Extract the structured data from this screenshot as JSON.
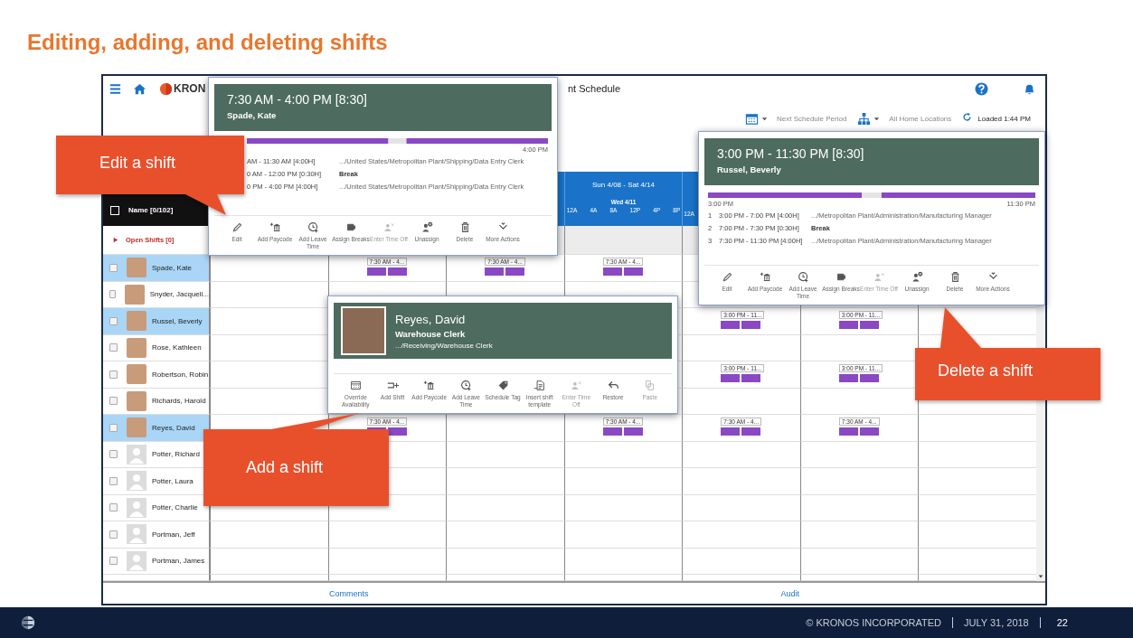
{
  "slide": {
    "title": "Editing, adding, and deleting shifts",
    "footer": {
      "copyright": "© KRONOS INCORPORATED",
      "date": "JULY 31, 2018",
      "page": "22"
    }
  },
  "app": {
    "logo_text": "KRON",
    "title": "nt Schedule",
    "toolbar": {
      "period": "Next Schedule Period",
      "locations": "All Home Locations",
      "loaded": "Loaded 1:44 PM"
    }
  },
  "schedule": {
    "range": "Sun 4/08 - Sat 4/14",
    "day": "Wed 4/11",
    "hours": [
      "12A",
      "4A",
      "8A",
      "12P",
      "4P",
      "8P",
      "12A"
    ],
    "name_header": "Name [0/102]",
    "select_all_checked": false,
    "open_shifts": "Open Shifts [0]",
    "employees": [
      {
        "name": "Spade, Kate",
        "selected": true,
        "checked": false,
        "has_photo": true,
        "shifts": {
          "mon": "7:30 AM - 4...",
          "tue": "7:30 AM - 4...",
          "wed": "7:30 AM - 4..."
        }
      },
      {
        "name": "Snyder, Jacqueli...",
        "selected": false,
        "checked": false,
        "has_photo": true
      },
      {
        "name": "Russel, Beverly",
        "selected": true,
        "checked": false,
        "has_photo": true,
        "shifts": {
          "thu": "3:00 PM - 11...",
          "fri": "3:00 PM - 11..."
        }
      },
      {
        "name": "Rose, Kathleen",
        "selected": false,
        "checked": false,
        "has_photo": true
      },
      {
        "name": "Robertson, Robin",
        "selected": false,
        "checked": false,
        "has_photo": true,
        "shifts": {
          "thu": "3:00 PM - 11...",
          "fri": "3:00 PM - 11..."
        }
      },
      {
        "name": "Richards, Harold",
        "selected": false,
        "checked": false,
        "has_photo": true
      },
      {
        "name": "Reyes, David",
        "selected": true,
        "checked": false,
        "has_photo": true,
        "shifts": {
          "mon": "7:30 AM - 4...",
          "wed": "7:30 AM - 4...",
          "thu": "7:30 AM - 4...",
          "fri": "7:30 AM - 4..."
        }
      },
      {
        "name": "Potter, Richard",
        "selected": false,
        "checked": false,
        "has_photo": false
      },
      {
        "name": "Potter, Laura",
        "selected": false,
        "checked": false,
        "has_photo": false
      },
      {
        "name": "Potter, Charlie",
        "selected": false,
        "checked": false,
        "has_photo": false
      },
      {
        "name": "Portman, Jeff",
        "selected": false,
        "checked": false,
        "has_photo": false
      },
      {
        "name": "Portman, James",
        "selected": false,
        "checked": false,
        "has_photo": false
      }
    ],
    "links": [
      "Comments",
      "Audit"
    ]
  },
  "popups": [
    {
      "kind": "shift",
      "time": "7:30 AM - 4:00 PM [8:30]",
      "name": "Spade, Kate",
      "end_label": "4:00 PM",
      "segments": [
        {
          "kind": "work",
          "time": "AM - 11:30 AM [4:00H]",
          "detail": ".../United States/Metropolitan Plant/Shipping/Data Entry Clerk"
        },
        {
          "kind": "break",
          "time": "0 AM - 12:00 PM [0:30H]",
          "detail": "Break"
        },
        {
          "kind": "work",
          "time": "0 PM - 4:00 PM [4:00H]",
          "detail": ".../United States/Metropolitan Plant/Shipping/Data Entry Clerk"
        }
      ],
      "actions": [
        {
          "kind": "edit",
          "label": "Edit",
          "disabled": false
        },
        {
          "kind": "paycode",
          "label": "Add Paycode",
          "disabled": false
        },
        {
          "kind": "leave",
          "label": "Add Leave Time",
          "disabled": false
        },
        {
          "kind": "breaks",
          "label": "Assign Breaks",
          "disabled": false
        },
        {
          "kind": "timeoff",
          "label": "Enter Time Off",
          "disabled": true
        },
        {
          "kind": "unassign",
          "label": "Unassign",
          "disabled": false
        },
        {
          "kind": "delete",
          "label": "Delete",
          "disabled": false
        },
        {
          "kind": "more",
          "label": "More Actions",
          "disabled": false
        }
      ]
    },
    {
      "kind": "shift",
      "time": "3:00 PM - 11:30 PM [8:30]",
      "name": "Russel, Beverly",
      "start_label": "3:00 PM",
      "end_label": "11:30 PM",
      "segments": [
        {
          "kind": "work",
          "number": "1",
          "time": "3:00 PM - 7:00 PM [4:00H]",
          "detail": ".../Metropolitan Plant/Administration/Manufacturing Manager"
        },
        {
          "kind": "break",
          "number": "2",
          "time": "7:00 PM - 7:30 PM [0:30H]",
          "detail": "Break"
        },
        {
          "kind": "work",
          "number": "3",
          "time": "7:30 PM - 11:30 PM [4:00H]",
          "detail": ".../Metropolitan Plant/Administration/Manufacturing Manager"
        }
      ],
      "actions": [
        {
          "kind": "edit",
          "label": "Edit",
          "disabled": false
        },
        {
          "kind": "paycode",
          "label": "Add Paycode",
          "disabled": false
        },
        {
          "kind": "leave",
          "label": "Add Leave Time",
          "disabled": false
        },
        {
          "kind": "breaks",
          "label": "Assign Breaks",
          "disabled": false
        },
        {
          "kind": "timeoff",
          "label": "Enter Time Off",
          "disabled": true
        },
        {
          "kind": "unassign",
          "label": "Unassign",
          "disabled": false
        },
        {
          "kind": "delete",
          "label": "Delete",
          "disabled": false
        },
        {
          "kind": "more",
          "label": "More Actions",
          "disabled": false
        }
      ]
    },
    {
      "kind": "employee",
      "name": "Reyes, David",
      "job": "Warehouse Clerk",
      "path": ".../Receiving/Warehouse Clerk",
      "actions": [
        {
          "kind": "availability",
          "label": "Override Availability",
          "disabled": false
        },
        {
          "kind": "addshift",
          "label": "Add Shift",
          "disabled": false
        },
        {
          "kind": "paycode",
          "label": "Add Paycode",
          "disabled": false
        },
        {
          "kind": "leave",
          "label": "Add Leave Time",
          "disabled": false
        },
        {
          "kind": "tag",
          "label": "Schedule Tag",
          "disabled": false
        },
        {
          "kind": "template",
          "label": "Insert shift template",
          "disabled": false
        },
        {
          "kind": "timeoff",
          "label": "Enter Time Off",
          "disabled": true
        },
        {
          "kind": "restore",
          "label": "Restore",
          "disabled": false
        },
        {
          "kind": "paste",
          "label": "Paste",
          "disabled": true
        }
      ]
    }
  ],
  "callouts": [
    "Edit a shift",
    "Add a shift",
    "Delete a shift"
  ]
}
